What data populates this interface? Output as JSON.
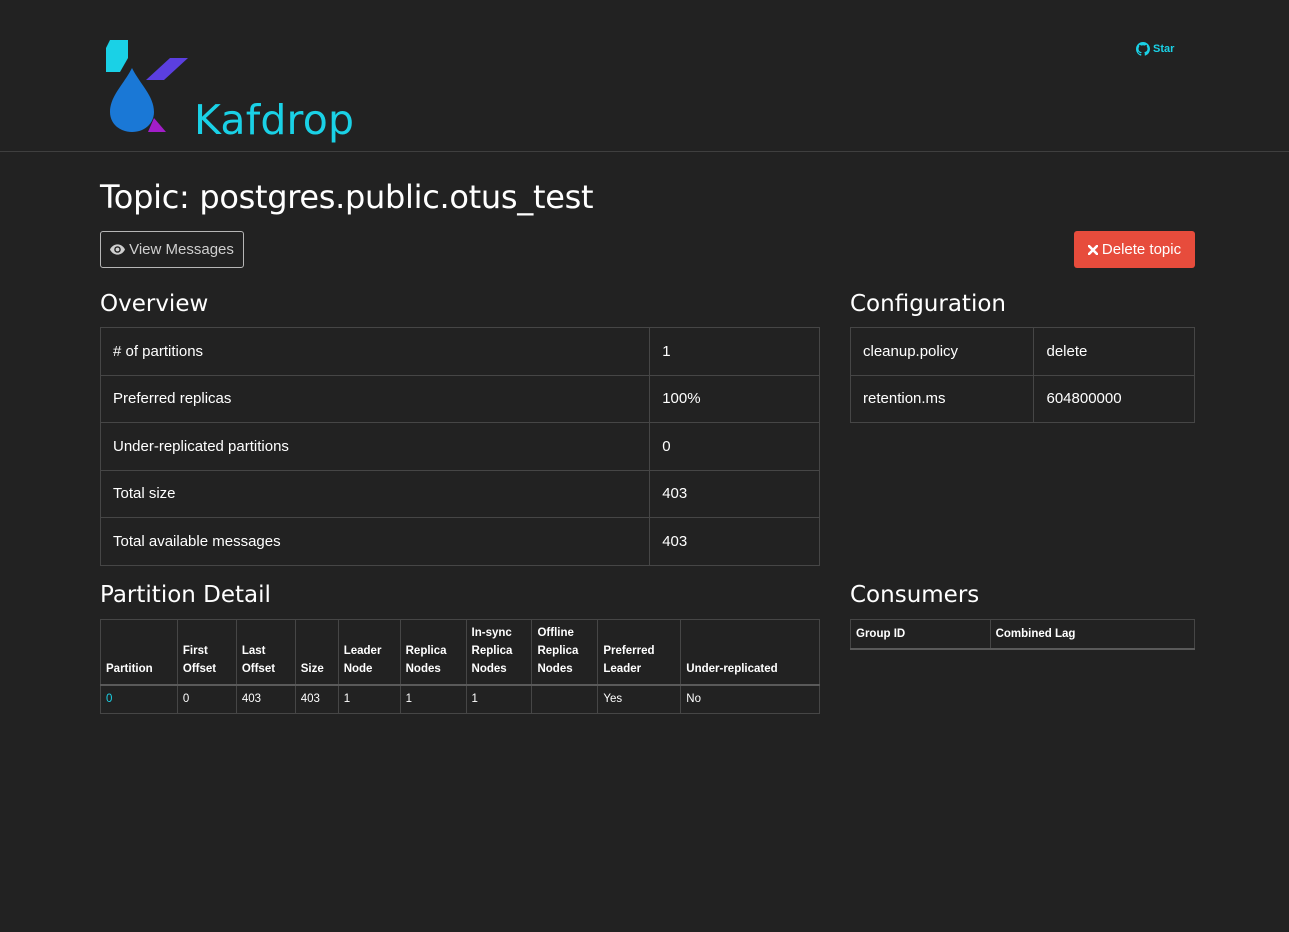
{
  "header": {
    "brand": "Kafdrop",
    "star_label": "Star"
  },
  "page": {
    "title": "Topic: postgres.public.otus_test"
  },
  "actions": {
    "view_messages": "View Messages",
    "delete_topic": "Delete topic"
  },
  "overview": {
    "heading": "Overview",
    "rows": [
      {
        "label": "# of partitions",
        "value": "1"
      },
      {
        "label": "Preferred replicas",
        "value": "100%"
      },
      {
        "label": "Under-replicated partitions",
        "value": "0"
      },
      {
        "label": "Total size",
        "value": "403"
      },
      {
        "label": "Total available messages",
        "value": "403"
      }
    ]
  },
  "configuration": {
    "heading": "Configuration",
    "rows": [
      {
        "label": "cleanup.policy",
        "value": "delete"
      },
      {
        "label": "retention.ms",
        "value": "604800000"
      }
    ]
  },
  "partition_detail": {
    "heading": "Partition Detail",
    "columns": [
      {
        "l1": "",
        "l2": "",
        "l3": "Partition"
      },
      {
        "l1": "",
        "l2": "First",
        "l3": "Offset"
      },
      {
        "l1": "",
        "l2": "Last",
        "l3": "Offset"
      },
      {
        "l1": "",
        "l2": "",
        "l3": "Size"
      },
      {
        "l1": "",
        "l2": "Leader",
        "l3": "Node"
      },
      {
        "l1": "",
        "l2": "Replica",
        "l3": "Nodes"
      },
      {
        "l1": "In-sync",
        "l2": "Replica",
        "l3": "Nodes"
      },
      {
        "l1": "Offline",
        "l2": "Replica",
        "l3": "Nodes"
      },
      {
        "l1": "",
        "l2": "Preferred",
        "l3": "Leader"
      },
      {
        "l1": "",
        "l2": "",
        "l3": "Under-replicated"
      }
    ],
    "rows": [
      [
        "0",
        "0",
        "403",
        "403",
        "1",
        "1",
        "1",
        "",
        "Yes",
        "No"
      ]
    ]
  },
  "consumers": {
    "heading": "Consumers",
    "columns": [
      "Group ID",
      "Combined Lag"
    ]
  },
  "colors": {
    "background": "#222222",
    "accent": "#1ad1e6",
    "danger": "#e74c3c"
  },
  "icons": {
    "star": "github-icon",
    "view": "eye-icon",
    "delete": "times-icon"
  }
}
